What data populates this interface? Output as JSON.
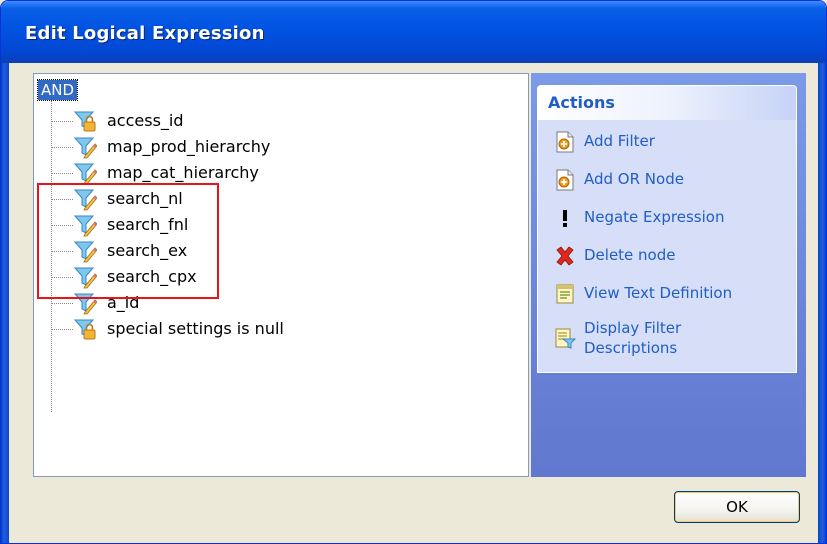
{
  "window": {
    "title": "Edit Logical Expression"
  },
  "tree": {
    "root_label": "AND",
    "items": [
      {
        "label": "access_id",
        "icon": "lock-condition-icon"
      },
      {
        "label": "map_prod_hierarchy",
        "icon": "filter-icon"
      },
      {
        "label": "map_cat_hierarchy",
        "icon": "filter-icon"
      },
      {
        "label": "search_nl",
        "icon": "filter-icon"
      },
      {
        "label": "search_fnl",
        "icon": "filter-icon"
      },
      {
        "label": "search_ex",
        "icon": "filter-icon"
      },
      {
        "label": "search_cpx",
        "icon": "filter-icon"
      },
      {
        "label": "a_id",
        "icon": "filter-icon"
      },
      {
        "label": "special settings is null",
        "icon": "lock-condition-icon"
      }
    ]
  },
  "actions": {
    "header": "Actions",
    "items": [
      {
        "label": "Add Filter",
        "icon": "add-filter-icon"
      },
      {
        "label": "Add OR Node",
        "icon": "add-or-node-icon"
      },
      {
        "label": "Negate Expression",
        "icon": "exclamation-icon"
      },
      {
        "label": "Delete node",
        "icon": "red-x-icon"
      },
      {
        "label": "View Text Definition",
        "icon": "text-document-icon"
      },
      {
        "label": "Display Filter Descriptions",
        "icon": "filter-description-icon"
      }
    ]
  },
  "footer": {
    "ok_label": "OK"
  },
  "colors": {
    "title_bar": "#0053e1",
    "highlight_border": "#e8141b",
    "action_link": "#215dc6",
    "selection": "#316ac5"
  }
}
